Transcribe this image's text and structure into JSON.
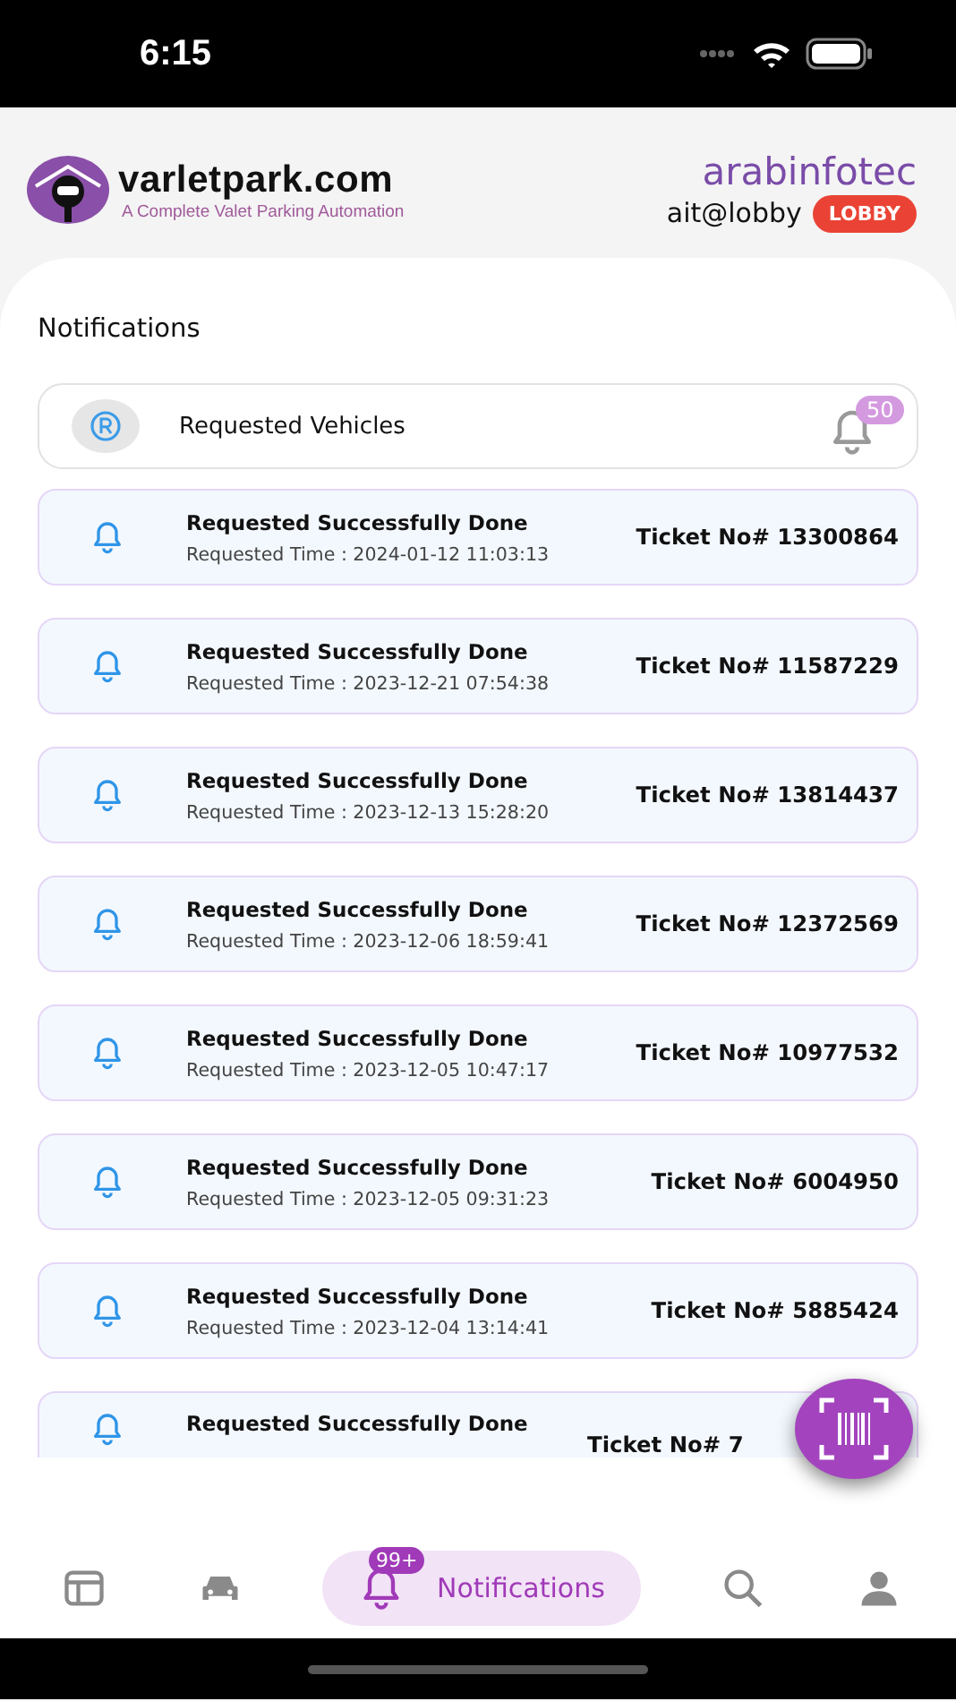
{
  "status_bar": {
    "time": "6:15"
  },
  "header": {
    "brand": "varletpark.com",
    "tagline": "A Complete Valet Parking Automation",
    "company": "arabinfotec",
    "user": "ait@lobby",
    "role_badge": "LOBBY"
  },
  "section_title": "Notifications",
  "summary": {
    "label": "Requested Vehicles",
    "count": "50"
  },
  "notifications": [
    {
      "title": "Requested Successfully Done",
      "time": "Requested Time : 2024-01-12 11:03:13",
      "ticket": "Ticket No# 13300864"
    },
    {
      "title": "Requested Successfully Done",
      "time": "Requested Time : 2023-12-21 07:54:38",
      "ticket": "Ticket No# 11587229"
    },
    {
      "title": "Requested Successfully Done",
      "time": "Requested Time : 2023-12-13 15:28:20",
      "ticket": "Ticket No# 13814437"
    },
    {
      "title": "Requested Successfully Done",
      "time": "Requested Time : 2023-12-06 18:59:41",
      "ticket": "Ticket No# 12372569"
    },
    {
      "title": "Requested Successfully Done",
      "time": "Requested Time : 2023-12-05 10:47:17",
      "ticket": "Ticket No# 10977532"
    },
    {
      "title": "Requested Successfully Done",
      "time": "Requested Time : 2023-12-05 09:31:23",
      "ticket": "Ticket No# 6004950"
    },
    {
      "title": "Requested Successfully Done",
      "time": "Requested Time : 2023-12-04 13:14:41",
      "ticket": "Ticket No# 5885424"
    },
    {
      "title": "Requested Successfully Done",
      "ticket": "Ticket No# 7"
    }
  ],
  "nav": [
    {
      "kind": "dashboard",
      "selected": false
    },
    {
      "kind": "car",
      "selected": false
    },
    {
      "kind": "notifications",
      "label": "Notifications",
      "badge": "99+",
      "selected": true
    },
    {
      "kind": "search",
      "selected": false
    },
    {
      "kind": "profile",
      "selected": false
    }
  ]
}
